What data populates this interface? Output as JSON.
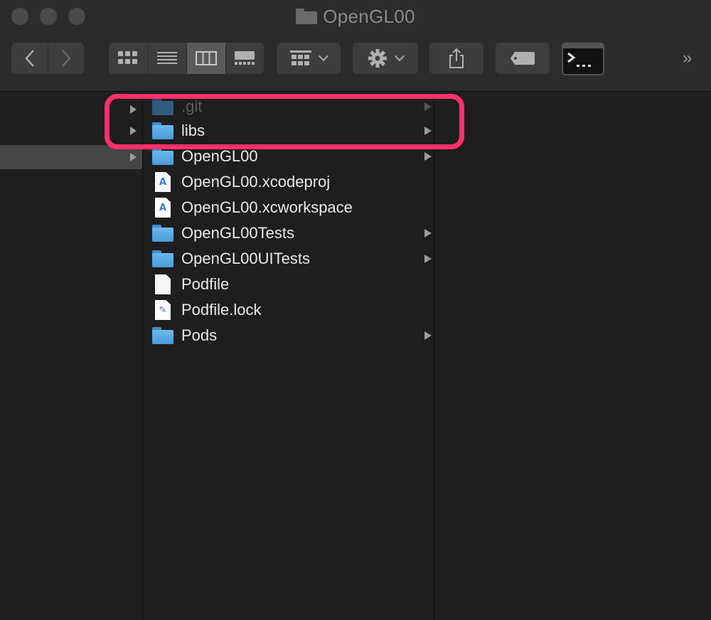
{
  "window": {
    "title": "OpenGL00"
  },
  "toolbar": {
    "back_icon": "chevron-left-icon",
    "forward_icon": "chevron-right-icon",
    "view_modes": [
      "icon-view",
      "list-view",
      "column-view",
      "gallery-view"
    ],
    "selected_view": "column-view",
    "more_glyph": "»"
  },
  "sidebar_column": {
    "selected_row_has_arrow": true
  },
  "files": [
    {
      "name": ".git",
      "type": "folder",
      "has_children": true,
      "faded": true
    },
    {
      "name": "libs",
      "type": "folder",
      "has_children": true,
      "highlighted": true
    },
    {
      "name": "OpenGL00",
      "type": "folder",
      "has_children": true
    },
    {
      "name": "OpenGL00.xcodeproj",
      "type": "xcodeproj",
      "has_children": false
    },
    {
      "name": "OpenGL00.xcworkspace",
      "type": "xcworkspace",
      "has_children": false
    },
    {
      "name": "OpenGL00Tests",
      "type": "folder",
      "has_children": true
    },
    {
      "name": "OpenGL00UITests",
      "type": "folder",
      "has_children": true
    },
    {
      "name": "Podfile",
      "type": "document",
      "has_children": false
    },
    {
      "name": "Podfile.lock",
      "type": "document-lock",
      "has_children": false
    },
    {
      "name": "Pods",
      "type": "folder",
      "has_children": true
    }
  ],
  "colors": {
    "highlight": "#ff2f6d",
    "folder": "#5aa9e6",
    "background": "#1e1e1e"
  }
}
